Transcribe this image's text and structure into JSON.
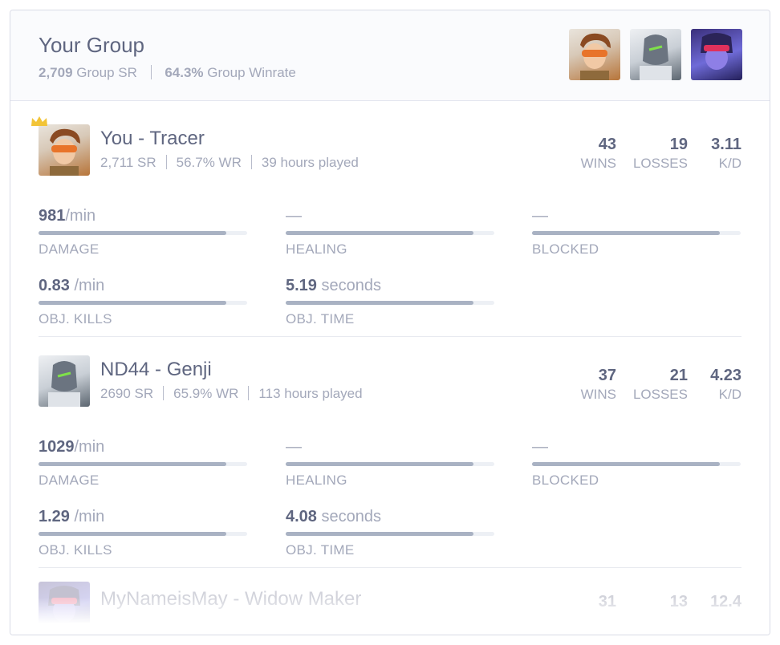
{
  "group": {
    "title": "Your Group",
    "sr_value": "2,709",
    "sr_label": "Group SR",
    "winrate_value": "64.3%",
    "winrate_label": "Group Winrate",
    "avatars": [
      "tracer-portrait-icon",
      "genji-portrait-icon",
      "widowmaker-portrait-icon"
    ]
  },
  "players": [
    {
      "name": "You - Tracer",
      "sr": "2,711 SR",
      "wr": "56.7% WR",
      "hours": "39 hours played",
      "wins": "43",
      "wins_label": "WINS",
      "losses": "19",
      "losses_label": "LOSSES",
      "kd": "3.11",
      "kd_label": "K/D",
      "damage": "981",
      "damage_unit": "/min",
      "damage_label": "DAMAGE",
      "healing": "—",
      "healing_label": "HEALING",
      "blocked": "—",
      "blocked_label": "BLOCKED",
      "objkills": "0.83",
      "objkills_unit": " /min",
      "objkills_label": "OBJ. KILLS",
      "objtime": "5.19",
      "objtime_unit": " seconds",
      "objtime_label": "OBJ. TIME",
      "bars": {
        "damage": 0.9,
        "healing": 0.9,
        "blocked": 0.9,
        "objkills": 0.9,
        "objtime": 0.9
      }
    },
    {
      "name": "ND44 - Genji",
      "sr": "2690 SR",
      "wr": "65.9% WR",
      "hours": "113 hours played",
      "wins": "37",
      "wins_label": "WINS",
      "losses": "21",
      "losses_label": "LOSSES",
      "kd": "4.23",
      "kd_label": "K/D",
      "damage": "1029",
      "damage_unit": "/min",
      "damage_label": "DAMAGE",
      "healing": "—",
      "healing_label": "HEALING",
      "blocked": "—",
      "blocked_label": "BLOCKED",
      "objkills": "1.29",
      "objkills_unit": " /min",
      "objkills_label": "OBJ. KILLS",
      "objtime": "4.08",
      "objtime_unit": " seconds",
      "objtime_label": "OBJ. TIME",
      "bars": {
        "damage": 0.9,
        "healing": 0.9,
        "blocked": 0.9,
        "objkills": 0.9,
        "objtime": 0.9
      }
    },
    {
      "name": "MyNameisMay - Widow Maker",
      "wins": "31",
      "losses": "13",
      "kd": "12.4"
    }
  ],
  "colors": {
    "accent_bar": "#a9b2c3",
    "crown": "#f2c437"
  }
}
